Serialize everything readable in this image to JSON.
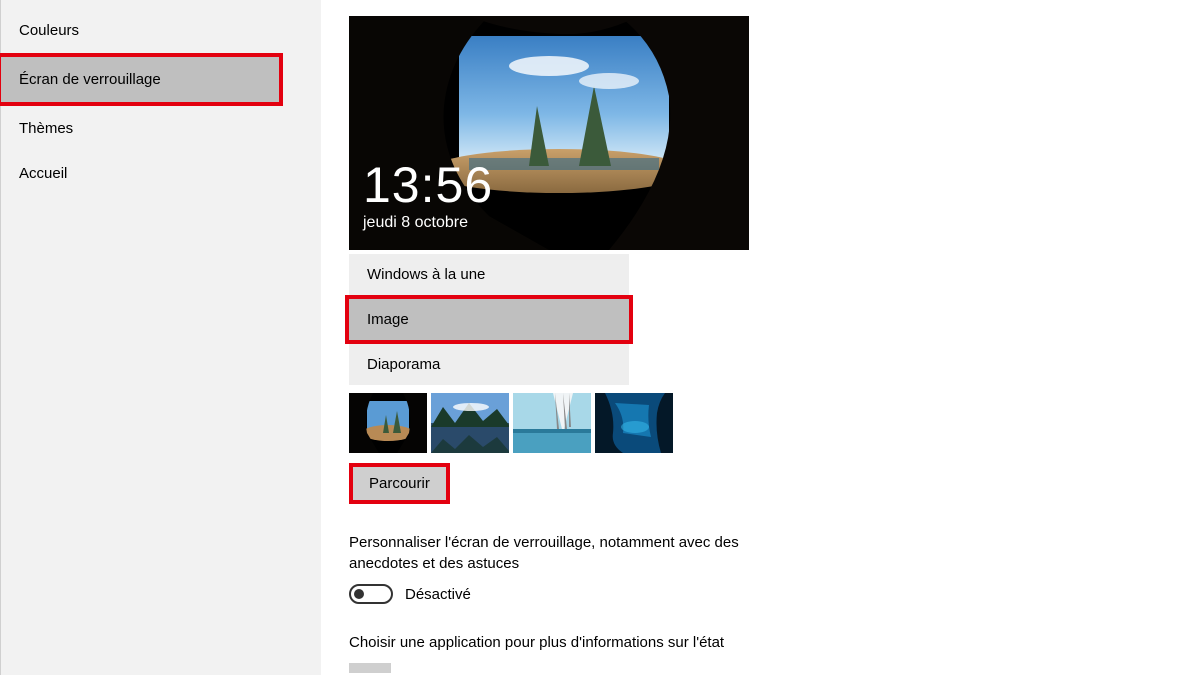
{
  "sidebar": {
    "items": [
      {
        "label": "Couleurs"
      },
      {
        "label": "Écran de verrouillage",
        "selected": true,
        "highlighted": true
      },
      {
        "label": "Thèmes"
      },
      {
        "label": "Accueil"
      }
    ]
  },
  "lockscreen": {
    "time": "13:56",
    "date": "jeudi 8 octobre"
  },
  "background": {
    "options": [
      {
        "label": "Windows à la une"
      },
      {
        "label": "Image",
        "selected": true,
        "highlighted": true
      },
      {
        "label": "Diaporama"
      }
    ],
    "browse_label": "Parcourir"
  },
  "tips": {
    "label": "Personnaliser l'écran de verrouillage, notamment avec des anecdotes et des astuces",
    "toggle_state": "Désactivé"
  },
  "status_app": {
    "label": "Choisir une application pour plus d'informations sur l'état"
  }
}
